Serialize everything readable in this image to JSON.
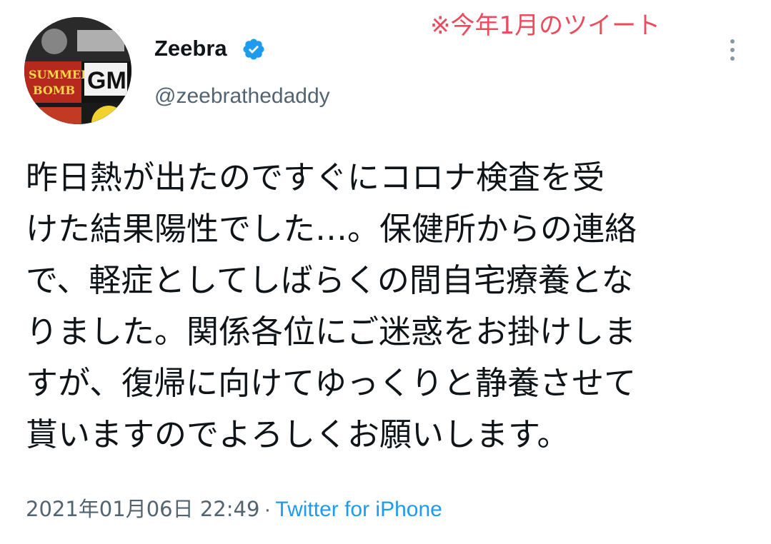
{
  "annotation": "※今年1月のツイート",
  "author": {
    "display_name": "Zeebra",
    "handle": "@zeebrathedaddy",
    "verified_icon": "verified-badge-icon",
    "avatar_text": {
      "top": "SUMMER",
      "mid": "BOMB",
      "badge": "GM"
    }
  },
  "tweet": {
    "lines": [
      "昨日熱が出たのですぐにコロナ検査を受",
      "けた結果陽性でした…。保健所からの連絡",
      "で、軽症としてしばらくの間自宅療養とな",
      "りました。関係各位にご迷惑をお掛けしま",
      "すが、復帰に向けてゆっくりと静養させて",
      "貰いますのでよろしくお願いします。"
    ],
    "timestamp": "2021年01月06日 22:49",
    "separator": "·",
    "source": "Twitter for iPhone"
  },
  "menu": {
    "icon": "more-vertical-icon"
  },
  "colors": {
    "accent": "#1d9bf0",
    "annotation": "#ef4a5c",
    "secondary_text": "#536471"
  }
}
